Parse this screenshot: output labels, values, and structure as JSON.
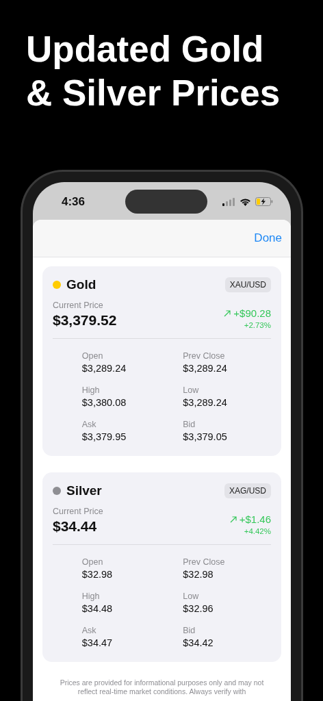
{
  "headline": "Updated Gold & Silver Prices",
  "status_bar": {
    "time": "4:36"
  },
  "sheet": {
    "done_button": "Done"
  },
  "metals": [
    {
      "name": "Gold",
      "color": "#ffcc00",
      "symbol": "XAU/USD",
      "price_label": "Current Price",
      "price": "$3,379.52",
      "change": "+$90.28",
      "change_percent": "+2.73%",
      "stats": [
        {
          "label": "Open",
          "value": "$3,289.24"
        },
        {
          "label": "Prev Close",
          "value": "$3,289.24"
        },
        {
          "label": "High",
          "value": "$3,380.08"
        },
        {
          "label": "Low",
          "value": "$3,289.24"
        },
        {
          "label": "Ask",
          "value": "$3,379.95"
        },
        {
          "label": "Bid",
          "value": "$3,379.05"
        }
      ]
    },
    {
      "name": "Silver",
      "color": "#8e8e93",
      "symbol": "XAG/USD",
      "price_label": "Current Price",
      "price": "$34.44",
      "change": "+$1.46",
      "change_percent": "+4.42%",
      "stats": [
        {
          "label": "Open",
          "value": "$32.98"
        },
        {
          "label": "Prev Close",
          "value": "$32.98"
        },
        {
          "label": "High",
          "value": "$34.48"
        },
        {
          "label": "Low",
          "value": "$32.96"
        },
        {
          "label": "Ask",
          "value": "$34.47"
        },
        {
          "label": "Bid",
          "value": "$34.42"
        }
      ]
    }
  ],
  "disclaimer": "Prices are provided for informational purposes only and may not reflect real-time market conditions. Always verify with"
}
